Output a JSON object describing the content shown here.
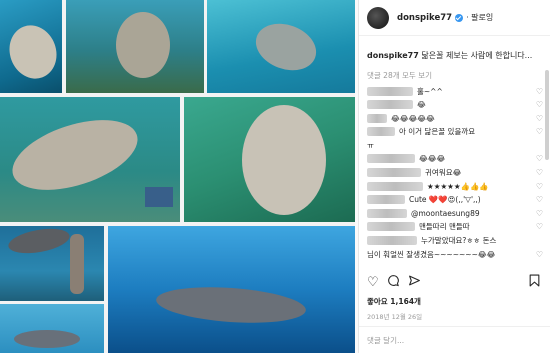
{
  "post": {
    "username": "donspike77",
    "follow_label": "팔로잉",
    "caption_text": "닮은꼴 제보는 사람에 한합니다...",
    "view_all_comments": "댓글 28개 모두 보기",
    "likes": "좋아요 1,164개",
    "date": "2018년 12월 26일",
    "add_comment_placeholder": "댓글 달기..."
  },
  "comments": [
    {
      "text": "홀~^^"
    },
    {
      "text": "😂"
    },
    {
      "text": "😂😂😂😂😂"
    },
    {
      "text": "아 이거 닮은꼴 있을까요"
    },
    {
      "text": "ㅠ"
    },
    {
      "text": "😂😂😂"
    },
    {
      "text": "귀여워요😂"
    },
    {
      "text": "★★★★★👍👍👍"
    },
    {
      "text": "Cute ❤️❤️😍(,,'▽',,)"
    },
    {
      "text": "@moontaesung89"
    },
    {
      "text": "맨들따리 맨들따"
    },
    {
      "text": "누가말았대요?ㅎㅎ 돈스"
    },
    {
      "text": "님이 훠얼씬 잘생겼음~~~~~~~😂😂"
    }
  ],
  "icons": {
    "like": "heart-icon",
    "comment": "comment-icon",
    "share": "share-icon",
    "save": "bookmark-icon"
  }
}
